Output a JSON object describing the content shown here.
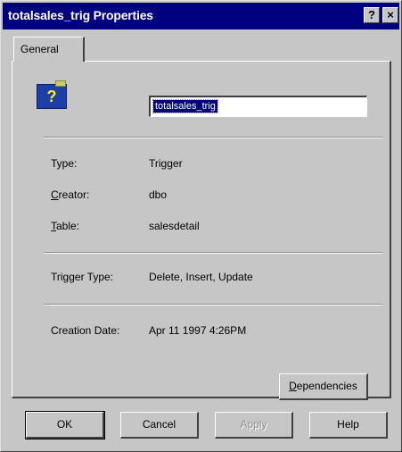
{
  "window": {
    "title": "totalsales_trig Properties",
    "help_glyph": "?",
    "close_glyph": "×"
  },
  "tabs": [
    {
      "label": "General"
    }
  ],
  "object": {
    "icon": "trigger-object-icon",
    "icon_glyph": "?",
    "name": "totalsales_trig"
  },
  "properties": {
    "type": {
      "label": "Type:",
      "value": "Trigger"
    },
    "creator": {
      "label_pre": "",
      "label_u": "C",
      "label_post": "reator:",
      "value": "dbo"
    },
    "table": {
      "label_pre": "",
      "label_u": "T",
      "label_post": "able:",
      "value": "salesdetail"
    },
    "trigger_type": {
      "label": "Trigger Type:",
      "value": "Delete, Insert, Update"
    },
    "creation_date": {
      "label": "Creation Date:",
      "value": "Apr 11 1997  4:26PM"
    }
  },
  "dependencies_button": {
    "label_u": "D",
    "label_post": "ependencies"
  },
  "footer_buttons": {
    "ok": "OK",
    "cancel": "Cancel",
    "apply": "Apply",
    "help": "Help"
  }
}
